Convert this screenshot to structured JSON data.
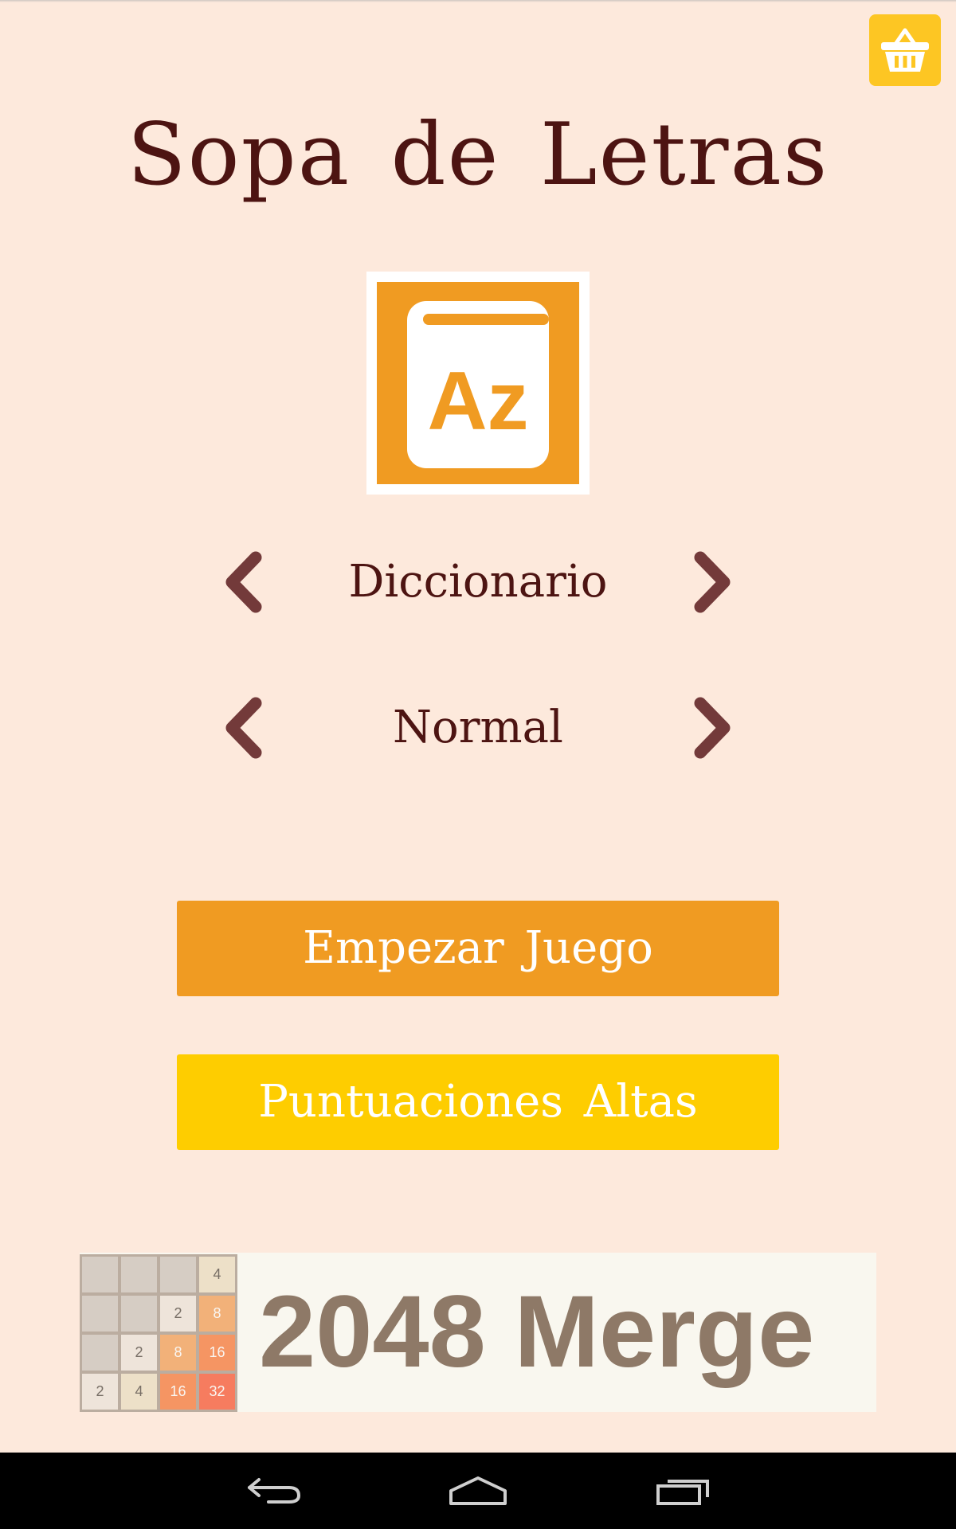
{
  "app": {
    "title": "Sopa de Letras"
  },
  "toolbar": {
    "shop_icon": "shopping-basket-icon"
  },
  "category": {
    "icon": "dictionary-az-icon",
    "icon_letters": "Az",
    "label": "Diccionario",
    "prev_icon": "chevron-left-icon",
    "next_icon": "chevron-right-icon"
  },
  "difficulty": {
    "label": "Normal",
    "prev_icon": "chevron-left-icon",
    "next_icon": "chevron-right-icon"
  },
  "buttons": {
    "start_label": "Empezar Juego",
    "scores_label": "Puntuaciones Altas"
  },
  "ad": {
    "text": "2048 Merge",
    "grid": [
      [
        "",
        "",
        "",
        "4"
      ],
      [
        "",
        "",
        "2",
        "8"
      ],
      [
        "",
        "2",
        "8",
        "16"
      ],
      [
        "2",
        "4",
        "16",
        "32"
      ]
    ]
  },
  "nav": {
    "back_icon": "back-icon",
    "home_icon": "home-icon",
    "recents_icon": "recent-apps-icon"
  },
  "colors": {
    "background": "#fde9dc",
    "title": "#4d1412",
    "accent_orange": "#f09b22",
    "accent_yellow": "#fecd00",
    "arrow": "#733a3a",
    "ad_text": "#8e7967"
  }
}
